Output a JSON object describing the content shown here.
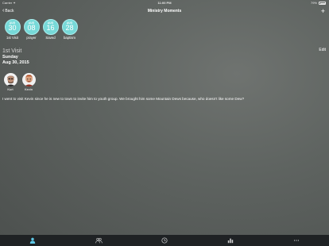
{
  "status_bar": {
    "carrier": "Carrier ✦",
    "time": "11:00 PM",
    "battery": "79%"
  },
  "nav": {
    "back_label": "Back",
    "title": "Ministry Moments",
    "add_symbol": "+"
  },
  "badges": [
    {
      "month": "AUG",
      "day": "30",
      "label": "1st Visit"
    },
    {
      "month": "AUG",
      "day": "08",
      "label": "prayer"
    },
    {
      "month": "AUG",
      "day": "16",
      "label": "Saved"
    },
    {
      "month": "AUG",
      "day": "28",
      "label": "baptism"
    }
  ],
  "detail": {
    "type": "1st Visit",
    "weekday": "Sunday",
    "date": "Aug 30, 2015",
    "edit_label": "Edit"
  },
  "people": [
    {
      "name": "Kurt"
    },
    {
      "name": "Kevin"
    }
  ],
  "note": "I went to visit Kevin since he is new to town to invite him to youth group. We brought him some Mountain Dews because, who doesn't like some Dew?",
  "tabs": [
    {
      "icon": "person-icon",
      "active": true
    },
    {
      "icon": "people-icon",
      "active": false
    },
    {
      "icon": "clock-icon",
      "active": false
    },
    {
      "icon": "chart-icon",
      "active": false
    },
    {
      "icon": "more-icon",
      "active": false
    }
  ],
  "colors": {
    "badge": "#77d9d8",
    "active_tab": "#5ec8e6",
    "tab_bar": "#1f2224"
  }
}
